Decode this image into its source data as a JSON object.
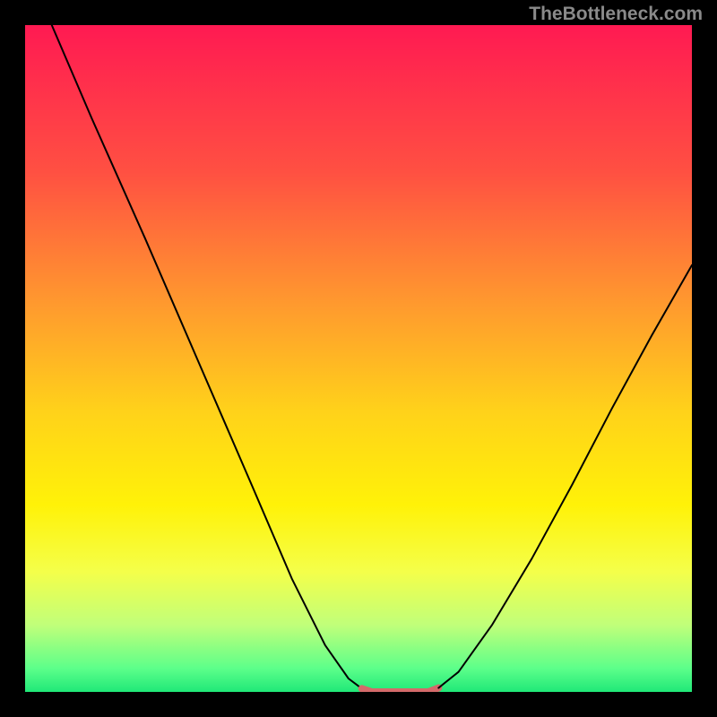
{
  "watermark": "TheBottleneck.com",
  "chart_data": {
    "type": "line",
    "title": "",
    "xlabel": "",
    "ylabel": "",
    "xlim": [
      0,
      100
    ],
    "ylim": [
      0,
      100
    ],
    "grid": false,
    "legend": false,
    "axes_visible": false,
    "background_gradient_stops": [
      {
        "offset": 0.0,
        "color": "#ff1a52"
      },
      {
        "offset": 0.22,
        "color": "#ff5042"
      },
      {
        "offset": 0.42,
        "color": "#ff9a2e"
      },
      {
        "offset": 0.58,
        "color": "#ffd21a"
      },
      {
        "offset": 0.72,
        "color": "#fff208"
      },
      {
        "offset": 0.82,
        "color": "#f4ff4a"
      },
      {
        "offset": 0.9,
        "color": "#c0ff7a"
      },
      {
        "offset": 0.965,
        "color": "#5cff8a"
      },
      {
        "offset": 1.0,
        "color": "#20e878"
      }
    ],
    "series": [
      {
        "name": "left-arm",
        "stroke": "#000000",
        "stroke_width": 2,
        "x": [
          4.0,
          10.0,
          18.0,
          26.0,
          34.0,
          40.0,
          45.0,
          48.5,
          50.5
        ],
        "y": [
          100.0,
          86.0,
          68.0,
          49.5,
          31.0,
          17.0,
          7.0,
          2.0,
          0.5
        ]
      },
      {
        "name": "valley-floor",
        "stroke": "#d46a6a",
        "stroke_width": 8,
        "x": [
          50.5,
          52.0,
          55.0,
          58.0,
          60.5,
          62.0
        ],
        "y": [
          0.5,
          0.0,
          0.0,
          0.0,
          0.0,
          0.6
        ]
      },
      {
        "name": "right-arm",
        "stroke": "#000000",
        "stroke_width": 2,
        "x": [
          62.0,
          65.0,
          70.0,
          76.0,
          82.0,
          88.0,
          94.0,
          100.0
        ],
        "y": [
          0.6,
          3.0,
          10.0,
          20.0,
          31.0,
          42.5,
          53.5,
          64.0
        ]
      }
    ]
  }
}
